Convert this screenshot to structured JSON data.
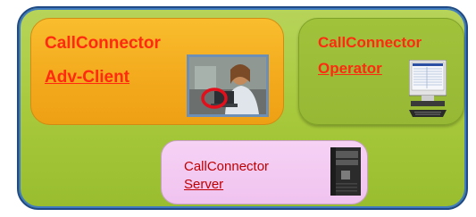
{
  "diagram": {
    "client": {
      "title": "CallConnector",
      "link": "Adv-Client"
    },
    "operator": {
      "title": "CallConnector",
      "link": "Operator"
    },
    "server": {
      "title": "CallConnector",
      "link": "Server"
    }
  },
  "colors": {
    "outer_fill": "#a6c83a",
    "outer_border": "#1f4a84",
    "client_fill": "#f3a91c",
    "operator_fill": "#96b834",
    "server_fill": "#f0c3ef",
    "label_red": "#ff2a10",
    "server_text": "#c00000"
  },
  "icons": {
    "client_photo": "person-at-computer-photo",
    "operator": "desktop-computer-icon",
    "server": "server-tower-icon"
  }
}
